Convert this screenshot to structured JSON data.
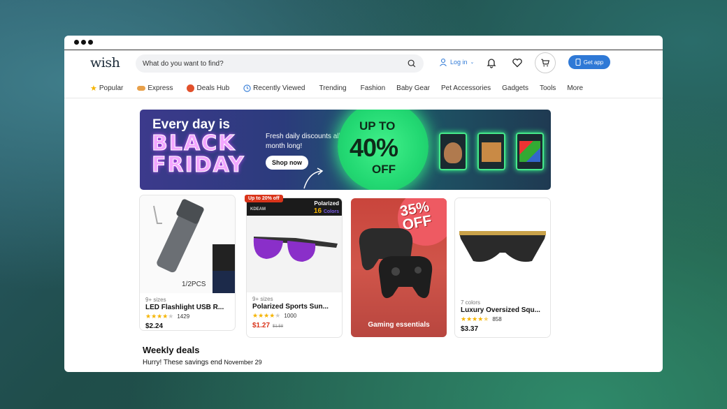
{
  "app": {
    "logo": "wish"
  },
  "search": {
    "placeholder": "What do you want to find?"
  },
  "header": {
    "login_label": "Log in",
    "get_app_label": "Get app"
  },
  "nav": [
    {
      "label": "Popular",
      "icon": "star-icon"
    },
    {
      "label": "Express",
      "icon": "express-icon"
    },
    {
      "label": "Deals Hub",
      "icon": "deals-icon"
    },
    {
      "label": "Recently Viewed",
      "icon": "clock-icon"
    },
    {
      "label": "Trending"
    },
    {
      "label": "Fashion"
    },
    {
      "label": "Baby Gear"
    },
    {
      "label": "Pet Accessories"
    },
    {
      "label": "Gadgets"
    },
    {
      "label": "Tools"
    },
    {
      "label": "More"
    }
  ],
  "banner": {
    "line1": "Every day is",
    "line2": "BLACK",
    "line3": "FRIDAY",
    "sub": "Fresh daily discounts all month long!",
    "cta": "Shop now",
    "up_to": "UP TO",
    "percent": "40%",
    "off": "OFF"
  },
  "products": [
    {
      "sizes": "9+ sizes",
      "name": "LED Flashlight USB R...",
      "rating": 3.5,
      "reviews": "1429",
      "price": "$2.24",
      "image_text": "1/2PCS"
    },
    {
      "badge": "Up to 20% off",
      "sizes": "9+ sizes",
      "name": "Polarized Sports Sun...",
      "rating": 4,
      "reviews": "1000",
      "price": "$1.27",
      "old_price": "$1.58",
      "image_text_1": "Polarized",
      "image_text_2": "16",
      "image_text_3": "Colors",
      "image_brand": "KDEAM"
    },
    {
      "sizes": "7 colors",
      "name": "Luxury Oversized Squ...",
      "rating": 4.5,
      "reviews": "858",
      "price": "$3.37"
    }
  ],
  "promo": {
    "percent": "35%",
    "off": "OFF",
    "label": "Gaming essentials"
  },
  "weekly": {
    "title": "Weekly deals",
    "sub": "Hurry! These savings end",
    "date": "November 29"
  }
}
